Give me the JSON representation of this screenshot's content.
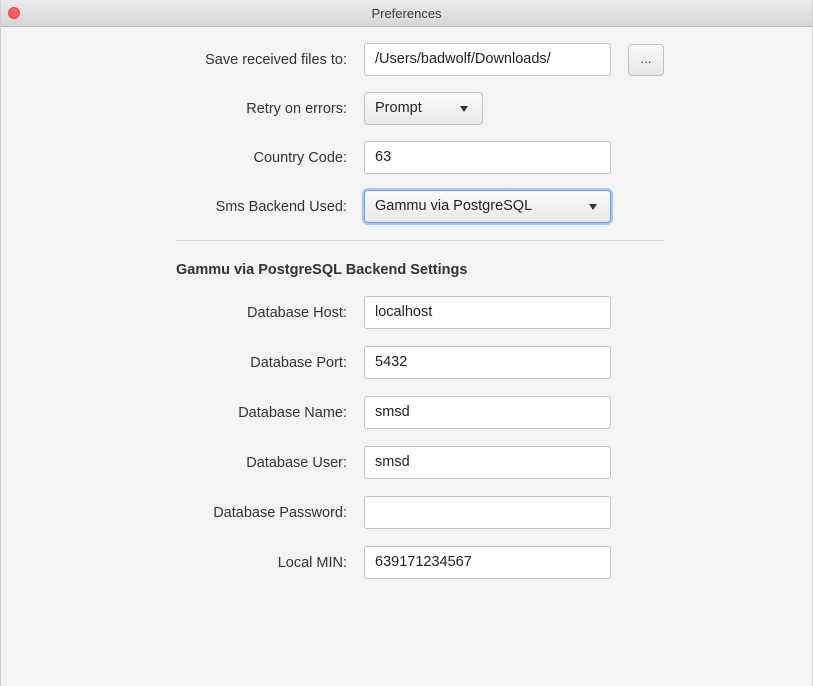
{
  "window": {
    "title": "Preferences"
  },
  "general": {
    "save_label": "Save received files to:",
    "save_value": "/Users/badwolf/Downloads/",
    "browse_label": "...",
    "retry_label": "Retry on errors:",
    "retry_value": "Prompt",
    "country_label": "Country Code:",
    "country_value": "63",
    "backend_label": "Sms Backend Used:",
    "backend_value": "Gammu via PostgreSQL"
  },
  "backend": {
    "section_title": "Gammu via PostgreSQL Backend Settings",
    "fields": [
      {
        "label": "Database Host:",
        "value": "localhost"
      },
      {
        "label": "Database Port:",
        "value": "5432"
      },
      {
        "label": "Database Name:",
        "value": "smsd"
      },
      {
        "label": "Database User:",
        "value": "smsd"
      },
      {
        "label": "Database Password:",
        "value": ""
      },
      {
        "label": "Local MIN:",
        "value": "639171234567"
      }
    ]
  },
  "icons": {
    "close": "close-icon",
    "dropdown": "chevron-down-icon"
  },
  "colors": {
    "close_button": "#fc5f57",
    "focus_ring": "#a9c8f2"
  }
}
